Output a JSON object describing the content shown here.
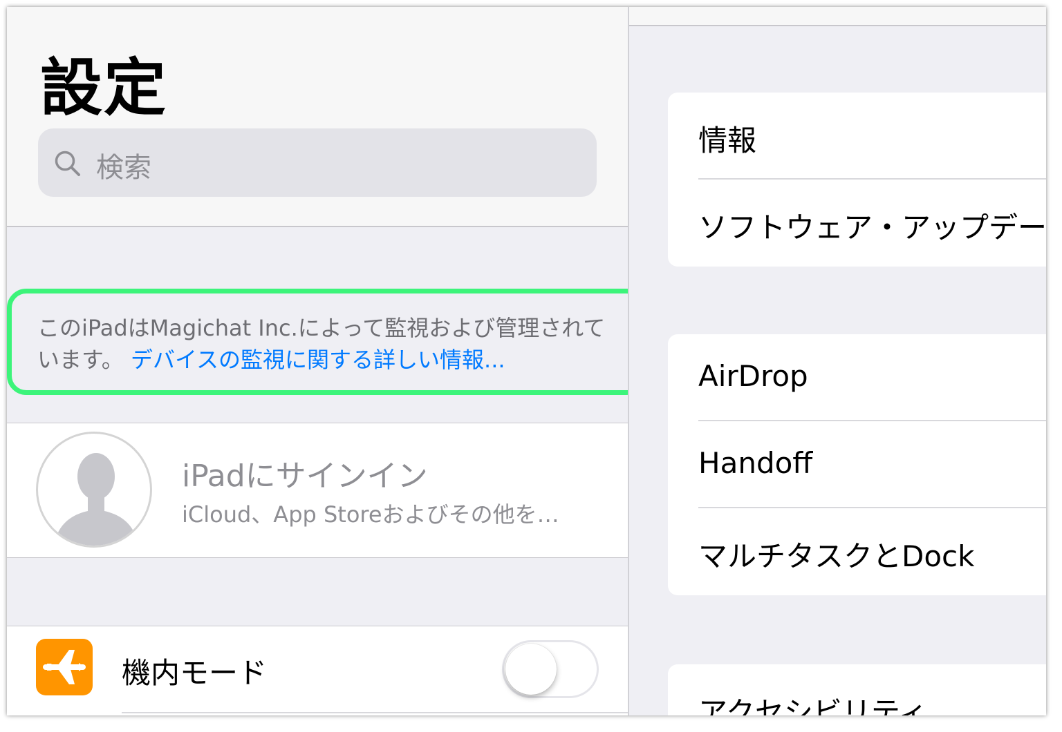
{
  "settings": {
    "title": "設定",
    "search": {
      "placeholder": "検索",
      "icon": "search-icon"
    },
    "supervision": {
      "message": "このiPadはMagichat Inc.によって監視および管理されています。",
      "link_text": "デバイスの監視に関する詳しい情報..."
    },
    "signin": {
      "title": "iPadにサインイン",
      "subtitle": "iCloud、App Storeおよびその他を…"
    },
    "airplane": {
      "label": "機内モード",
      "icon": "airplane-icon",
      "badge_color": "#ff9500",
      "enabled": false
    }
  },
  "general": {
    "groups": [
      {
        "items": [
          "情報",
          "ソフトウェア・アップデート"
        ]
      },
      {
        "items": [
          "AirDrop",
          "Handoff",
          "マルチタスクとDock"
        ]
      },
      {
        "items": [
          "アクセシビリティ"
        ]
      }
    ]
  },
  "colors": {
    "link": "#007aff",
    "highlight": "#3cf47a",
    "background": "#efeff4"
  }
}
